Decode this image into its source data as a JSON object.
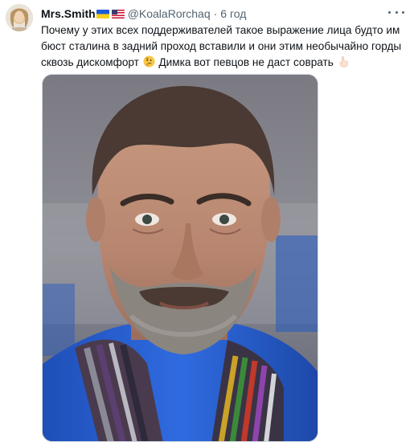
{
  "tweet": {
    "author_name": "Mrs.Smith",
    "handle": "@KoalaRorchaq",
    "separator": "·",
    "time": "6 год",
    "text_part1": "Почему у этих всех поддерживателей такое выражение лица будто им бюст сталина в задний проход вставили и они этим необычайно горды сквозь дискомфорт",
    "text_part2": "Димка вот певцов не даст соврать",
    "emoji_1": "thinking-face-emoji",
    "emoji_2": "pointing-hand-emoji",
    "flags": [
      "ukraine-flag",
      "usa-flag"
    ],
    "photo": "portrait-photo-man-with-beard-and-striped-scarf"
  },
  "colors": {
    "text_primary": "#0f1419",
    "text_secondary": "#536471",
    "border": "#cfd9de"
  }
}
